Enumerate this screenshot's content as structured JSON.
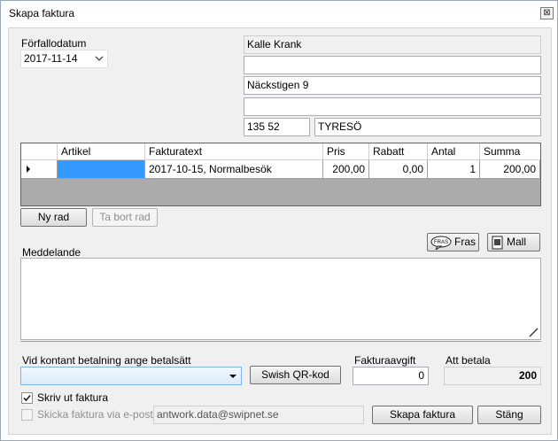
{
  "window": {
    "title": "Skapa faktura",
    "close_glyph": "⊠"
  },
  "due_date": {
    "label": "Förfallodatum",
    "value": "2017-11-14"
  },
  "address": {
    "name": "Kalle Krank",
    "line2": "",
    "street": "Näckstigen 9",
    "line4": "",
    "zip": "135 52",
    "city": "TYRESÖ"
  },
  "grid": {
    "columns": [
      "Artikel",
      "Fakturatext",
      "Pris",
      "Rabatt",
      "Antal",
      "Summa"
    ],
    "rows": [
      {
        "artikel": "",
        "text": "2017-10-15, Normalbesök",
        "pris": "200,00",
        "rabatt": "0,00",
        "antal": "1",
        "summa": "200,00"
      }
    ]
  },
  "buttons": {
    "new_row": "Ny rad",
    "delete_row": "Ta bort rad",
    "phrase": "Fras",
    "template": "Mall",
    "swish": "Swish QR-kod",
    "create_invoice": "Skapa faktura",
    "close": "Stäng"
  },
  "message": {
    "label": "Meddelande",
    "value": ""
  },
  "payment": {
    "label": "Vid kontant betalning ange betalsätt",
    "value": ""
  },
  "fee": {
    "label": "Fakturaavgift",
    "value": "0"
  },
  "to_pay": {
    "label": "Att betala",
    "value": "200"
  },
  "print_invoice": {
    "label": "Skriv ut faktura",
    "checked": true
  },
  "email_invoice": {
    "label": "Skicka faktura via e-post",
    "checked": false,
    "address": "antwork.data@swipnet.se"
  },
  "icons": [
    "close-icon",
    "dropdown-arrow-icon",
    "row-selector-icon",
    "phrase-icon",
    "template-icon",
    "resize-grip-icon",
    "checkmark-icon"
  ]
}
